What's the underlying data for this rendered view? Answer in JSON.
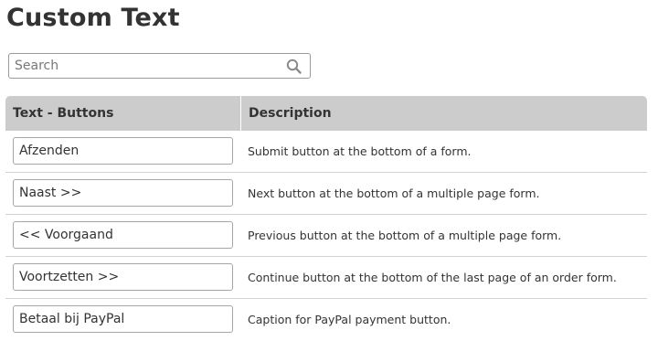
{
  "page": {
    "title": "Custom Text"
  },
  "search": {
    "placeholder": "Search",
    "value": "",
    "icon": "search-icon"
  },
  "table": {
    "columns": [
      "Text - Buttons",
      "Description"
    ],
    "rows": [
      {
        "value": "Afzenden",
        "description": "Submit button at the bottom of a form."
      },
      {
        "value": "Naast >>",
        "description": "Next button at the bottom of a multiple page form."
      },
      {
        "value": "<< Voorgaand",
        "description": "Previous button at the bottom of a multiple page form."
      },
      {
        "value": "Voortzetten >>",
        "description": "Continue button at the bottom of the last page of an order form."
      },
      {
        "value": "Betaal bij PayPal",
        "description": "Caption for PayPal payment button."
      }
    ]
  },
  "colors": {
    "header_background": "#cccccc",
    "text": "#333333",
    "border": "#a6a6a6",
    "divider": "#d3d3d3"
  }
}
